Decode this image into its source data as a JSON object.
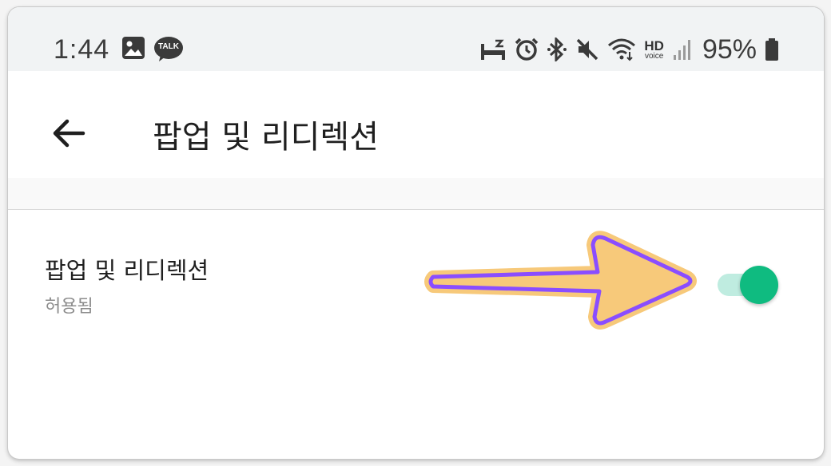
{
  "status_bar": {
    "time": "1:44",
    "battery_percent": "95%",
    "hd_label": "HD",
    "voice_label": "voice",
    "talk_badge": "TALK",
    "left_icons": [
      "gallery-icon",
      "kakaotalk-icon"
    ],
    "right_icons": [
      "sleep-mode-icon",
      "alarm-icon",
      "bluetooth-icon",
      "mute-icon",
      "wifi-icon",
      "hd-voice-icon",
      "signal-icon",
      "battery-icon"
    ]
  },
  "app_bar": {
    "title": "팝업 및 리디렉션",
    "back_icon": "arrow-back-icon"
  },
  "setting": {
    "title": "팝업 및 리디렉션",
    "subtitle": "허용됨",
    "toggle_on": true
  },
  "colors": {
    "toggle_thumb": "#0fbb80",
    "toggle_track": "#bfece0",
    "annotation_fill": "#f7c97a",
    "annotation_stroke": "#8a4dff"
  }
}
